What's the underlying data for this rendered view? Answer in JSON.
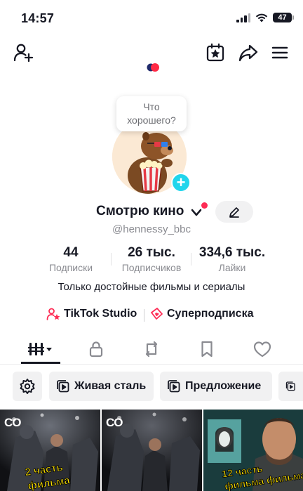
{
  "status_bar": {
    "time": "14:57",
    "battery": "47"
  },
  "profile": {
    "bubble_text": "Что хорошего?",
    "display_name": "Смотрю кино",
    "username": "@hennessy_bbc",
    "bio": "Только достойные фильмы и сериалы"
  },
  "stats": [
    {
      "value": "44",
      "label": "Подписки"
    },
    {
      "value": "26 тыс.",
      "label": "Подписчиков"
    },
    {
      "value": "334,6 тыс.",
      "label": "Лайки"
    }
  ],
  "links": {
    "studio": "TikTok Studio",
    "subscription": "Суперподписка"
  },
  "tabs": [
    "videos-tab",
    "private-tab",
    "reposts-tab",
    "favorites-tab",
    "liked-tab"
  ],
  "playlists": [
    {
      "label": "Живая сталь"
    },
    {
      "label": "Предложение"
    }
  ],
  "videos": [
    {
      "badge": "CO",
      "caption_line1": "2 часть",
      "caption_line2": "фильма"
    },
    {
      "badge": "CO",
      "caption_line1": "",
      "caption_line2": ""
    },
    {
      "badge": "",
      "caption_line1": "12 часть",
      "caption_line2": "фильма фильма"
    }
  ],
  "colors": {
    "accent": "#fe2c55",
    "cyan": "#20d5ec",
    "caption_yellow": "#ffe400"
  }
}
